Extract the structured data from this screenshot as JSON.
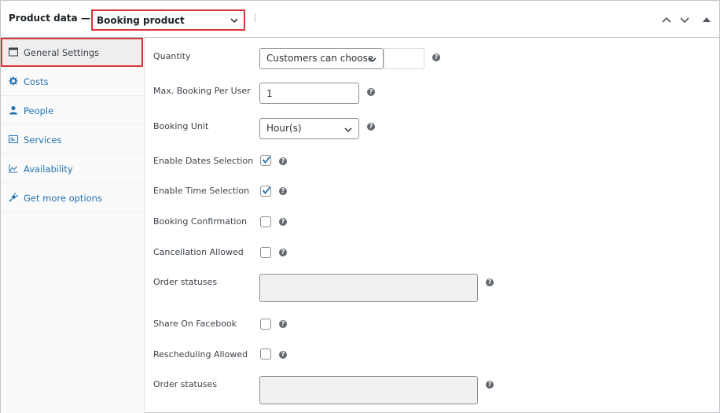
{
  "header": {
    "title": "Product data —",
    "product_type": "Booking product"
  },
  "sidebar": {
    "items": [
      {
        "label": "General Settings",
        "icon": "window-icon",
        "active": true
      },
      {
        "label": "Costs",
        "icon": "gear-icon"
      },
      {
        "label": "People",
        "icon": "person-icon"
      },
      {
        "label": "Services",
        "icon": "list-icon"
      },
      {
        "label": "Availability",
        "icon": "chart-icon"
      },
      {
        "label": "Get more options",
        "icon": "plugin-icon"
      }
    ]
  },
  "fields": {
    "quantity": {
      "label": "Quantity",
      "value": "Customers can choose"
    },
    "max_booking": {
      "label": "Max. Booking Per User",
      "value": "1"
    },
    "booking_unit": {
      "label": "Booking Unit",
      "value": "Hour(s)"
    },
    "enable_dates": {
      "label": "Enable Dates Selection",
      "checked": true
    },
    "enable_time": {
      "label": "Enable Time Selection",
      "checked": true
    },
    "booking_confirmation": {
      "label": "Booking Confirmation",
      "checked": false
    },
    "cancellation": {
      "label": "Cancellation Allowed",
      "checked": false
    },
    "order_statuses_1": {
      "label": "Order statuses",
      "value": ""
    },
    "share_facebook": {
      "label": "Share On Facebook",
      "checked": false
    },
    "rescheduling": {
      "label": "Rescheduling Allowed",
      "checked": false
    },
    "order_statuses_2": {
      "label": "Order statuses",
      "value": ""
    }
  },
  "help_glyph": "?",
  "colors": {
    "link": "#2271b1",
    "highlight_border": "#d63638",
    "checkmark": "#2271b1"
  }
}
